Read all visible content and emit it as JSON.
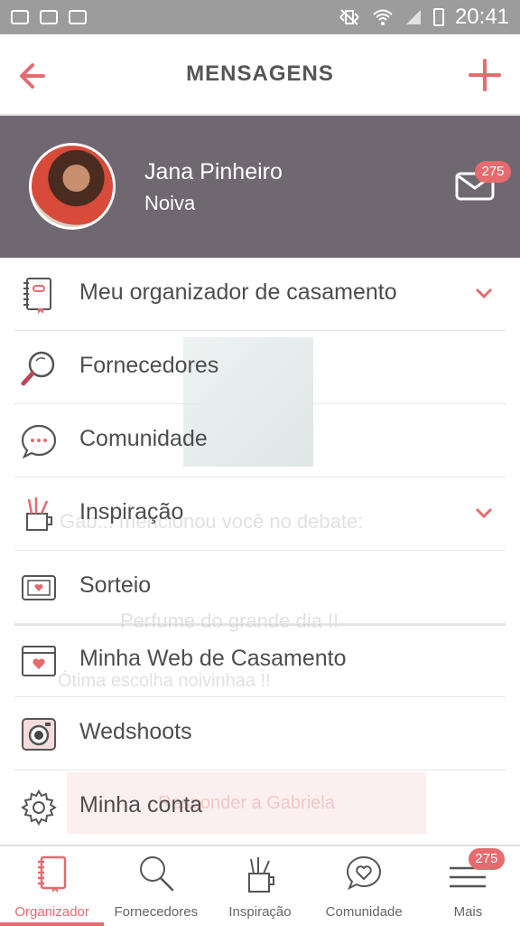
{
  "status_bar": {
    "time": "20:41",
    "left_icons": [
      "at-icon",
      "voicemail-icon",
      "briefcase-icon"
    ],
    "right_icons": [
      "mute-vibrate-icon",
      "wifi-icon",
      "signal-icon",
      "battery-icon"
    ]
  },
  "header": {
    "title": "MENSAGENS",
    "back_icon": "arrow-left-icon",
    "add_icon": "plus-icon",
    "accent_color": "#e56b6f"
  },
  "profile": {
    "name": "Jana Pinheiro",
    "role": "Noiva",
    "mail_badge": "275",
    "background_color": "#6f6870"
  },
  "menu": {
    "items": [
      {
        "label": "Meu organizador de casamento",
        "icon": "organizer-notebook-icon",
        "has_chevron": true
      },
      {
        "label": "Fornecedores",
        "icon": "magnifier-icon",
        "has_chevron": false
      },
      {
        "label": "Comunidade",
        "icon": "chat-bubble-icon",
        "has_chevron": false
      },
      {
        "label": "Inspiração",
        "icon": "pencil-cup-icon",
        "has_chevron": true
      },
      {
        "label": "Sorteio",
        "icon": "ticket-icon",
        "has_chevron": false
      },
      {
        "label": "Minha Web de Casamento",
        "icon": "browser-heart-icon",
        "has_chevron": false
      },
      {
        "label": "Wedshoots",
        "icon": "camera-icon",
        "has_chevron": false
      },
      {
        "label": "Minha conta",
        "icon": "gear-icon",
        "has_chevron": false
      }
    ]
  },
  "background_content": {
    "mention_text": "Gab... mencionou você no debate:",
    "post_title": "Perfume do grande dia !!",
    "post_text": "Ótima escolha noivinhaa !!",
    "reply_button": "Responder a Gabriela"
  },
  "bottom_nav": {
    "tabs": [
      {
        "label": "Organizador",
        "icon": "organizer-notebook-icon",
        "active": true
      },
      {
        "label": "Fornecedores",
        "icon": "magnifier-icon",
        "active": false
      },
      {
        "label": "Inspiração",
        "icon": "pencil-cup-icon",
        "active": false
      },
      {
        "label": "Comunidade",
        "icon": "heart-bubble-icon",
        "active": false
      },
      {
        "label": "Mais",
        "icon": "hamburger-menu-icon",
        "active": false
      }
    ],
    "more_badge": "275"
  }
}
